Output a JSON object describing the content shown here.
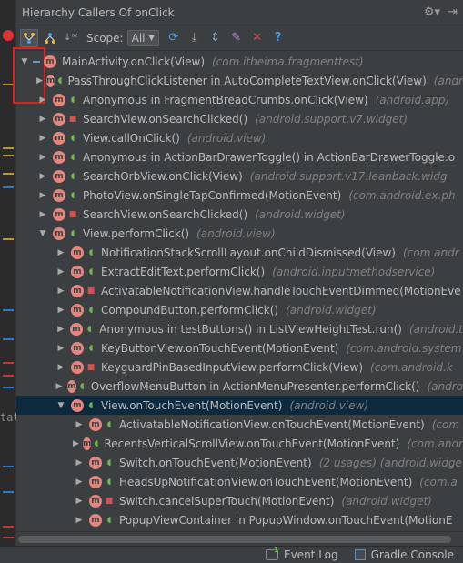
{
  "panel": {
    "title": "Hierarchy Callers Of onClick",
    "settings_icon": "gear-icon",
    "pin_icon": "hide-panel-icon"
  },
  "toolbar": {
    "scope_label": "Scope:",
    "scope_value": "All",
    "buttons": [
      "caller-hierarchy-icon",
      "callee-hierarchy-icon",
      "sort-alpha-icon",
      "refresh-icon",
      "export-icon",
      "autoscroll-icon",
      "pin-icon",
      "close-icon",
      "help-icon"
    ]
  },
  "tree": [
    {
      "indent": 0,
      "arrow": "down",
      "vis": "minus",
      "name": "MainActivity.onClick(View)",
      "pkg": "(com.itheima.fragmenttest)"
    },
    {
      "indent": 1,
      "arrow": "right",
      "vis": "pub",
      "name": "PassThroughClickListener in AutoCompleteTextView.onClick(View)",
      "pkg": "(andr"
    },
    {
      "indent": 1,
      "arrow": "right",
      "vis": "pub",
      "name": "Anonymous in FragmentBreadCrumbs.onClick(View)",
      "pkg": "(android.app)"
    },
    {
      "indent": 1,
      "arrow": "right",
      "vis": "priv",
      "name": "SearchView.onSearchClicked()",
      "pkg": "(android.support.v7.widget)"
    },
    {
      "indent": 1,
      "arrow": "right",
      "vis": "pub",
      "name": "View.callOnClick()",
      "pkg": "(android.view)"
    },
    {
      "indent": 1,
      "arrow": "right",
      "vis": "pub",
      "name": "Anonymous in ActionBarDrawerToggle() in ActionBarDrawerToggle.o",
      "pkg": ""
    },
    {
      "indent": 1,
      "arrow": "right",
      "vis": "pub",
      "name": "SearchOrbView.onClick(View)",
      "pkg": "(android.support.v17.leanback.widg"
    },
    {
      "indent": 1,
      "arrow": "right",
      "vis": "pub",
      "name": "PhotoView.onSingleTapConfirmed(MotionEvent)",
      "pkg": "(com.android.ex.ph"
    },
    {
      "indent": 1,
      "arrow": "right",
      "vis": "priv",
      "name": "SearchView.onSearchClicked()",
      "pkg": "(android.widget)"
    },
    {
      "indent": 1,
      "arrow": "down",
      "vis": "pub",
      "name": "View.performClick()",
      "pkg": "(android.view)"
    },
    {
      "indent": 2,
      "arrow": "right",
      "vis": "pub",
      "name": "NotificationStackScrollLayout.onChildDismissed(View)",
      "pkg": "(com.andr"
    },
    {
      "indent": 2,
      "arrow": "right",
      "vis": "pub",
      "name": "ExtractEditText.performClick()",
      "pkg": "(android.inputmethodservice)"
    },
    {
      "indent": 2,
      "arrow": "right",
      "vis": "priv",
      "name": "ActivatableNotificationView.handleTouchEventDimmed(MotionEve",
      "pkg": ""
    },
    {
      "indent": 2,
      "arrow": "right",
      "vis": "pub",
      "name": "CompoundButton.performClick()",
      "pkg": "(android.widget)"
    },
    {
      "indent": 2,
      "arrow": "right",
      "vis": "pub",
      "name": "Anonymous in testButtons() in ListViewHeightTest.run()",
      "pkg": "(android.t"
    },
    {
      "indent": 2,
      "arrow": "right",
      "vis": "pub",
      "name": "KeyButtonView.onTouchEvent(MotionEvent)",
      "pkg": "(com.android.system"
    },
    {
      "indent": 2,
      "arrow": "right",
      "vis": "priv",
      "name": "KeyguardPinBasedInputView.performClick(View)",
      "pkg": "(com.android.k"
    },
    {
      "indent": 2,
      "arrow": "right",
      "vis": "pub",
      "name": "OverflowMenuButton in ActionMenuPresenter.performClick()",
      "pkg": "(andro"
    },
    {
      "indent": 2,
      "arrow": "down",
      "vis": "pub",
      "name": "View.onTouchEvent(MotionEvent)",
      "pkg": "(android.view)",
      "selected": true
    },
    {
      "indent": 3,
      "arrow": "right",
      "vis": "pub",
      "name": "ActivatableNotificationView.onTouchEvent(MotionEvent)",
      "pkg": "(com"
    },
    {
      "indent": 3,
      "arrow": "right",
      "vis": "pub",
      "name": "RecentsVerticalScrollView.onTouchEvent(MotionEvent)",
      "pkg": "(com.andr"
    },
    {
      "indent": 3,
      "arrow": "right",
      "vis": "pub",
      "name": "Switch.onTouchEvent(MotionEvent)",
      "pkg": "(2 usages)  (android.widge"
    },
    {
      "indent": 3,
      "arrow": "right",
      "vis": "pub",
      "name": "HeadsUpNotificationView.onTouchEvent(MotionEvent)",
      "pkg": "(com.a"
    },
    {
      "indent": 3,
      "arrow": "right",
      "vis": "priv",
      "name": "Switch.cancelSuperTouch(MotionEvent)",
      "pkg": "(android.widget)"
    },
    {
      "indent": 3,
      "arrow": "right",
      "vis": "pub",
      "name": "PopupViewContainer in PopupWindow.onTouchEvent(MotionE",
      "pkg": ""
    }
  ],
  "statusbar": {
    "event_log_count": "1",
    "event_log_label": "Event Log",
    "gradle_label": "Gradle Console"
  },
  "gutter_text": "tat",
  "colors": {
    "background": "#3c3f41",
    "selection": "#0d293e",
    "method_icon": "#e2867e",
    "public_icon": "#6cba50",
    "private_icon": "#d25252",
    "highlight_box": "#e02020"
  }
}
